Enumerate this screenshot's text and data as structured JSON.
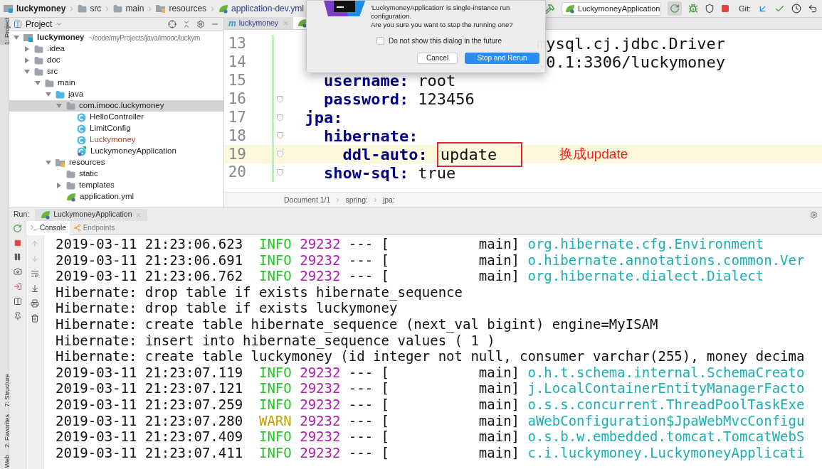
{
  "breadcrumb": [
    {
      "kind": "module",
      "label": "luckymoney"
    },
    {
      "kind": "folder",
      "label": "src"
    },
    {
      "kind": "folder",
      "label": "main"
    },
    {
      "kind": "resfolder",
      "label": "resources"
    },
    {
      "kind": "yml",
      "label": "application-dev.yml"
    }
  ],
  "toolbar": {
    "run_config": "LuckymoneyApplication",
    "git_label": "Git:"
  },
  "dialog": {
    "message": "'LuckymoneyApplication' is single-instance run configuration.",
    "question": "Are you sure you want to stop the running one?",
    "checkbox": {
      "label": "Do not show this dialog in the future",
      "checked": false
    },
    "buttons": [
      {
        "label": "Cancel",
        "default": false
      },
      {
        "label": "Stop and Rerun",
        "default": true
      }
    ]
  },
  "side_tabs_top": [
    {
      "label": "1: Project",
      "selected": true
    }
  ],
  "side_tabs_bottom": [
    {
      "label": "7: Structure",
      "selected": false
    },
    {
      "label": "2: Favorites",
      "selected": false
    },
    {
      "label": "Web",
      "selected": false
    }
  ],
  "project": {
    "title": "Project",
    "tree": [
      {
        "kind": "module",
        "label": "luckymoney",
        "path": "~/code/myProjects/java/imooc/luckym",
        "expanded": true,
        "selected": false,
        "unversioned": false,
        "children": [
          {
            "kind": "folder",
            "label": ".idea",
            "expanded": false,
            "selected": false,
            "unversioned": false
          },
          {
            "kind": "folder",
            "label": "doc",
            "expanded": false,
            "selected": false,
            "unversioned": false
          },
          {
            "kind": "folder",
            "label": "src",
            "expanded": true,
            "selected": false,
            "unversioned": false,
            "children": [
              {
                "kind": "folder",
                "label": "main",
                "expanded": true,
                "selected": false,
                "unversioned": false,
                "children": [
                  {
                    "kind": "source",
                    "label": "java",
                    "expanded": true,
                    "selected": false,
                    "unversioned": false,
                    "children": [
                      {
                        "kind": "package",
                        "label": "com.imooc.luckymoney",
                        "expanded": true,
                        "selected": true,
                        "unversioned": false,
                        "children": [
                          {
                            "kind": "class",
                            "label": "HelloController",
                            "selected": false,
                            "unversioned": false
                          },
                          {
                            "kind": "class",
                            "label": "LimitConfig",
                            "selected": false,
                            "unversioned": false
                          },
                          {
                            "kind": "class",
                            "label": "Luckymoney",
                            "selected": false,
                            "unversioned": true
                          },
                          {
                            "kind": "app",
                            "label": "LuckymoneyApplication",
                            "selected": false,
                            "unversioned": false
                          }
                        ]
                      }
                    ]
                  },
                  {
                    "kind": "resfolder",
                    "label": "resources",
                    "expanded": true,
                    "selected": false,
                    "unversioned": false,
                    "children": [
                      {
                        "kind": "package",
                        "label": "static",
                        "selected": false,
                        "unversioned": false
                      },
                      {
                        "kind": "package",
                        "label": "templates",
                        "expanded": false,
                        "selected": false,
                        "unversioned": false
                      },
                      {
                        "kind": "yml",
                        "label": "application.yml",
                        "selected": false,
                        "unversioned": false
                      }
                    ]
                  }
                ]
              }
            ]
          }
        ]
      }
    ]
  },
  "editor": {
    "tabs": [
      {
        "kind": "maven",
        "icon_text": "m",
        "label": "luckymoney",
        "selected": false
      },
      {
        "kind": "yml",
        "selected": true
      }
    ],
    "lines": [
      {
        "number": "13",
        "kind": "partial",
        "text": "mysql.cj.jdbc.Driver",
        "caret": false
      },
      {
        "number": "14",
        "kind": "partial",
        "text": ".0.1:3306/luckymoney",
        "caret": false
      },
      {
        "number": "15",
        "kind": "pair",
        "key": "    username:",
        "value": "root",
        "caret": false
      },
      {
        "number": "16",
        "kind": "pair",
        "key": "    password:",
        "value": "123456",
        "caret": false
      },
      {
        "number": "17",
        "kind": "pair",
        "key": "  jpa:",
        "caret": false
      },
      {
        "number": "18",
        "kind": "pair",
        "key": "    hibernate:",
        "caret": false
      },
      {
        "number": "19",
        "kind": "pair",
        "key": "      ddl-auto:",
        "value": "update",
        "caret": true,
        "note": "换成update"
      },
      {
        "number": "20",
        "kind": "pair",
        "key": "    show-sql:",
        "value": "true",
        "caret": false
      }
    ],
    "footer": [
      "Document 1/1",
      "spring:",
      "jpa:"
    ]
  },
  "run": {
    "label": "Run:",
    "tab": "LuckymoneyApplication",
    "subtabs": [
      {
        "kind": "console",
        "label": "Console",
        "selected": true
      },
      {
        "kind": "endpoints",
        "label": "Endpoints",
        "selected": false
      }
    ],
    "console": [
      {
        "kind": "log",
        "time": "2019-03-11 21:23:06.623",
        "severity": "INFO",
        "pid": "29232",
        "thread": "--- [           main]",
        "logger": "org.hibernate.cfg.Environment"
      },
      {
        "kind": "log",
        "time": "2019-03-11 21:23:06.691",
        "severity": "INFO",
        "pid": "29232",
        "thread": "--- [           main]",
        "logger": "o.hibernate.annotations.common.Ver"
      },
      {
        "kind": "log",
        "time": "2019-03-11 21:23:06.762",
        "severity": "INFO",
        "pid": "29232",
        "thread": "--- [           main]",
        "logger": "org.hibernate.dialect.Dialect"
      },
      {
        "kind": "sql",
        "text": "Hibernate: drop table if exists hibernate_sequence"
      },
      {
        "kind": "sql",
        "text": "Hibernate: drop table if exists luckymoney"
      },
      {
        "kind": "sql",
        "text": "Hibernate: create table hibernate_sequence (next_val bigint) engine=MyISAM"
      },
      {
        "kind": "sql",
        "text": "Hibernate: insert into hibernate_sequence values ( 1 )"
      },
      {
        "kind": "sql",
        "text": "Hibernate: create table luckymoney (id integer not null, consumer varchar(255), money decima"
      },
      {
        "kind": "log",
        "time": "2019-03-11 21:23:07.119",
        "severity": "INFO",
        "pid": "29232",
        "thread": "--- [           main]",
        "logger": "o.h.t.schema.internal.SchemaCreato"
      },
      {
        "kind": "log",
        "time": "2019-03-11 21:23:07.121",
        "severity": "INFO",
        "pid": "29232",
        "thread": "--- [           main]",
        "logger": "j.LocalContainerEntityManagerFacto"
      },
      {
        "kind": "log",
        "time": "2019-03-11 21:23:07.259",
        "severity": "INFO",
        "pid": "29232",
        "thread": "--- [           main]",
        "logger": "o.s.s.concurrent.ThreadPoolTaskExe"
      },
      {
        "kind": "log",
        "time": "2019-03-11 21:23:07.280",
        "severity": "WARN",
        "pid": "29232",
        "thread": "--- [           main]",
        "logger": "aWebConfiguration$JpaWebMvcConfigu"
      },
      {
        "kind": "log",
        "time": "2019-03-11 21:23:07.409",
        "severity": "INFO",
        "pid": "29232",
        "thread": "--- [           main]",
        "logger": "o.s.b.w.embedded.tomcat.TomcatWebS"
      },
      {
        "kind": "log",
        "time": "2019-03-11 21:23:07.411",
        "severity": "INFO",
        "pid": "29232",
        "thread": "--- [           main]",
        "logger": "c.i.luckymoney.LuckymoneyApplicati"
      }
    ]
  }
}
